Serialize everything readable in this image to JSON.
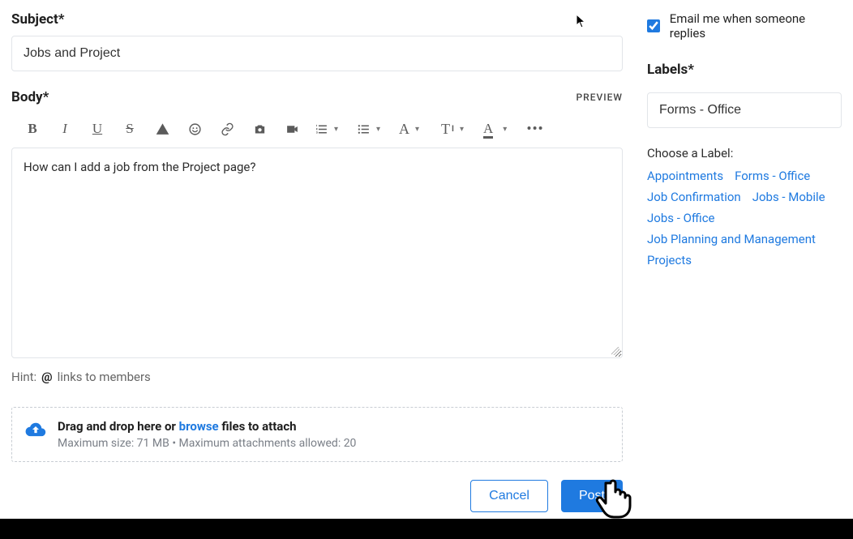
{
  "subject_label": "Subject*",
  "subject_value": "Jobs and Project",
  "body_label": "Body*",
  "preview_label": "PREVIEW",
  "body_text": "How can I add a job from the Project page?",
  "hint_label": "Hint:",
  "hint_at": "@",
  "hint_text": "links to members",
  "dropzone": {
    "prefix": "Drag and drop here or ",
    "browse": "browse",
    "suffix": " files to attach",
    "sub": "Maximum size: 71 MB • Maximum attachments allowed: 20"
  },
  "actions": {
    "cancel": "Cancel",
    "post": "Post"
  },
  "email_me": "Email me when someone replies",
  "labels_heading": "Labels*",
  "labels_value": "Forms - Office",
  "choose_label": "Choose a Label:",
  "tags": [
    "Appointments",
    "Forms - Office",
    "Job Confirmation",
    "Jobs - Mobile",
    "Jobs - Office",
    "Job Planning and Management",
    "Projects"
  ]
}
